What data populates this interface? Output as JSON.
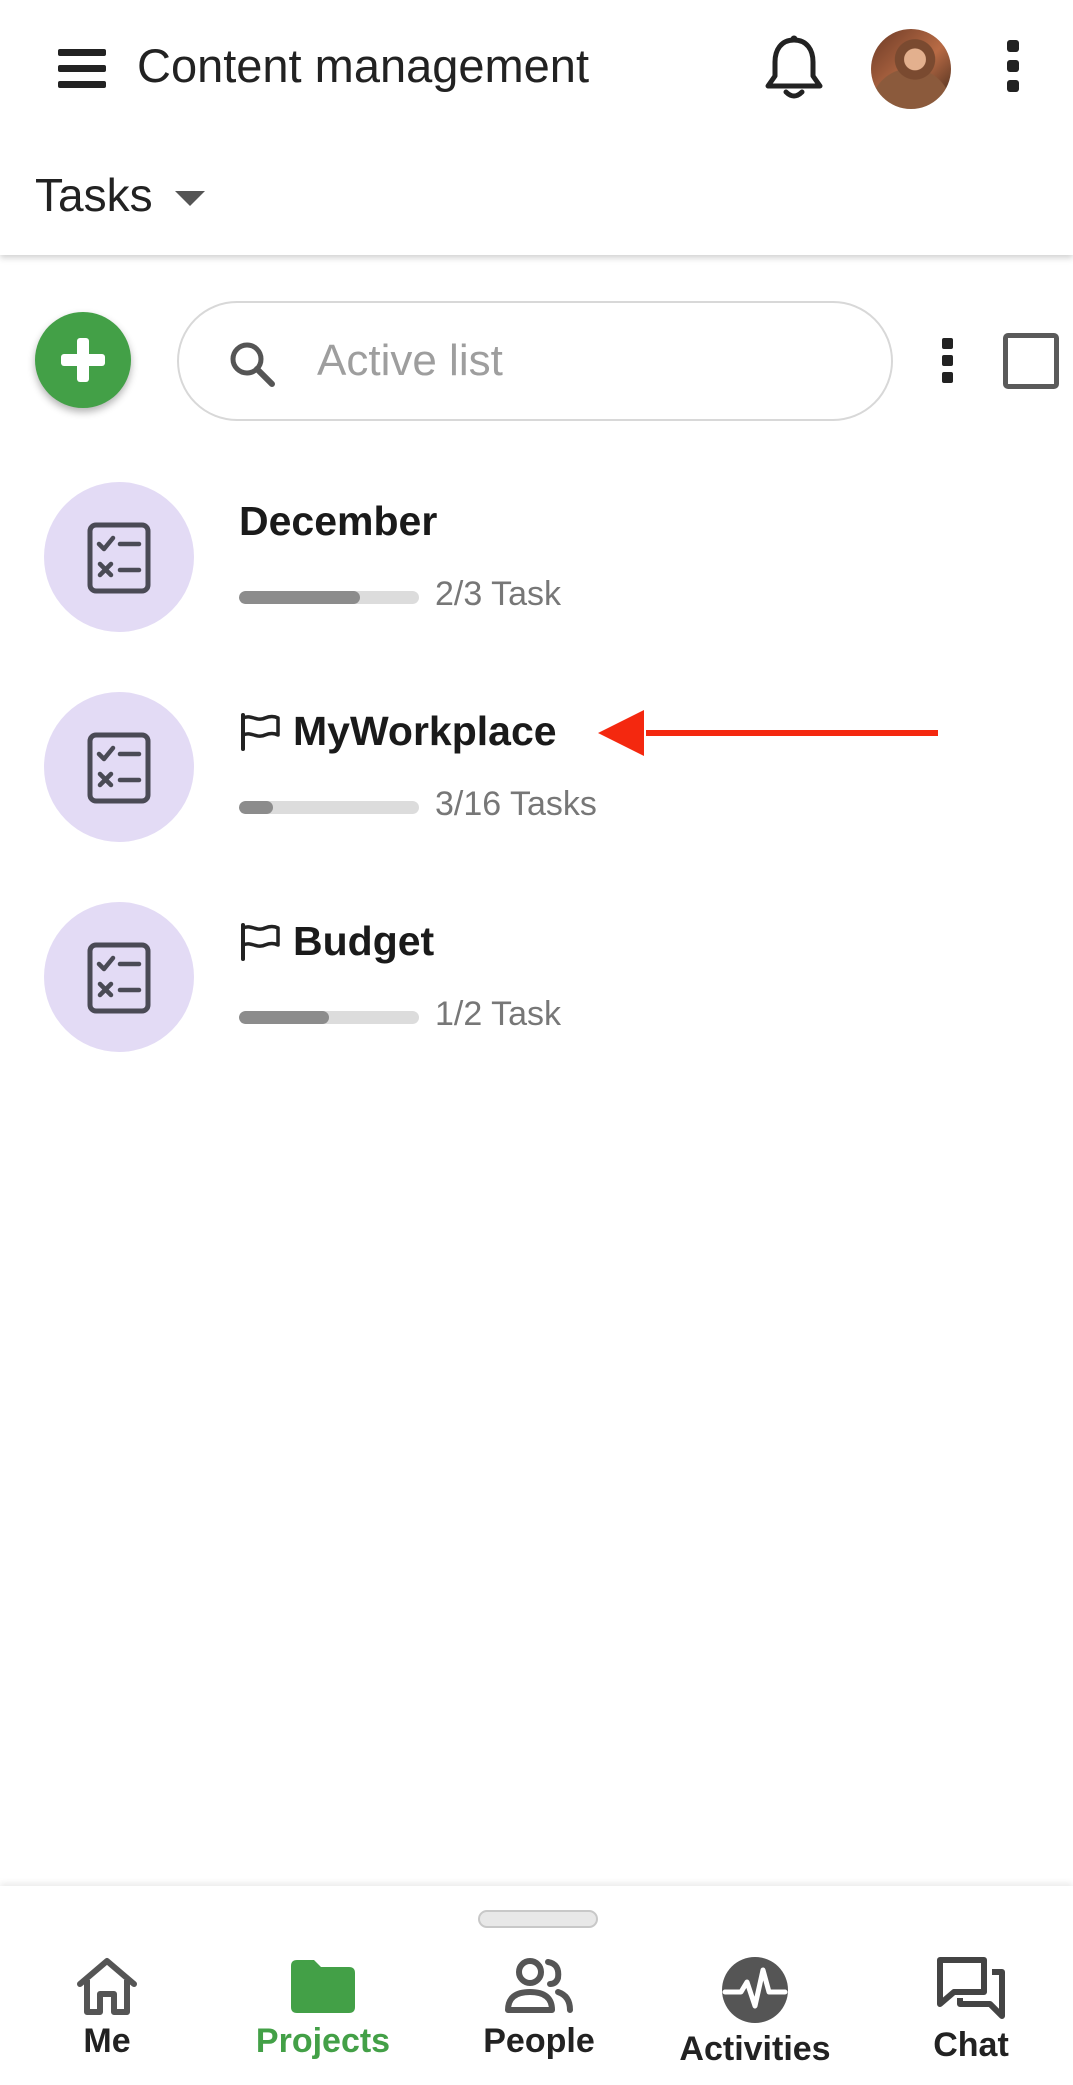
{
  "header": {
    "title": "Content management",
    "section_label": "Tasks"
  },
  "toolbar": {
    "search_placeholder": "Active list"
  },
  "task_lists": [
    {
      "name": "December",
      "count_label": "2/3 Task",
      "progress": 0.67,
      "flagged": false
    },
    {
      "name": "MyWorkplace",
      "count_label": "3/16 Tasks",
      "progress": 0.19,
      "flagged": true
    },
    {
      "name": "Budget",
      "count_label": "1/2 Task",
      "progress": 0.5,
      "flagged": true
    }
  ],
  "bottom_nav": {
    "items": [
      {
        "label": "Me",
        "icon": "home-icon",
        "active": false
      },
      {
        "label": "Projects",
        "icon": "folder-icon",
        "active": true
      },
      {
        "label": "People",
        "icon": "people-icon",
        "active": false
      },
      {
        "label": "Activities",
        "icon": "activity-icon",
        "active": false
      },
      {
        "label": "Chat",
        "icon": "chat-icon",
        "active": false
      }
    ]
  },
  "colors": {
    "accent_green": "#43a047",
    "task_circle": "#e3dbf5",
    "annotation_arrow": "#f4280f"
  }
}
